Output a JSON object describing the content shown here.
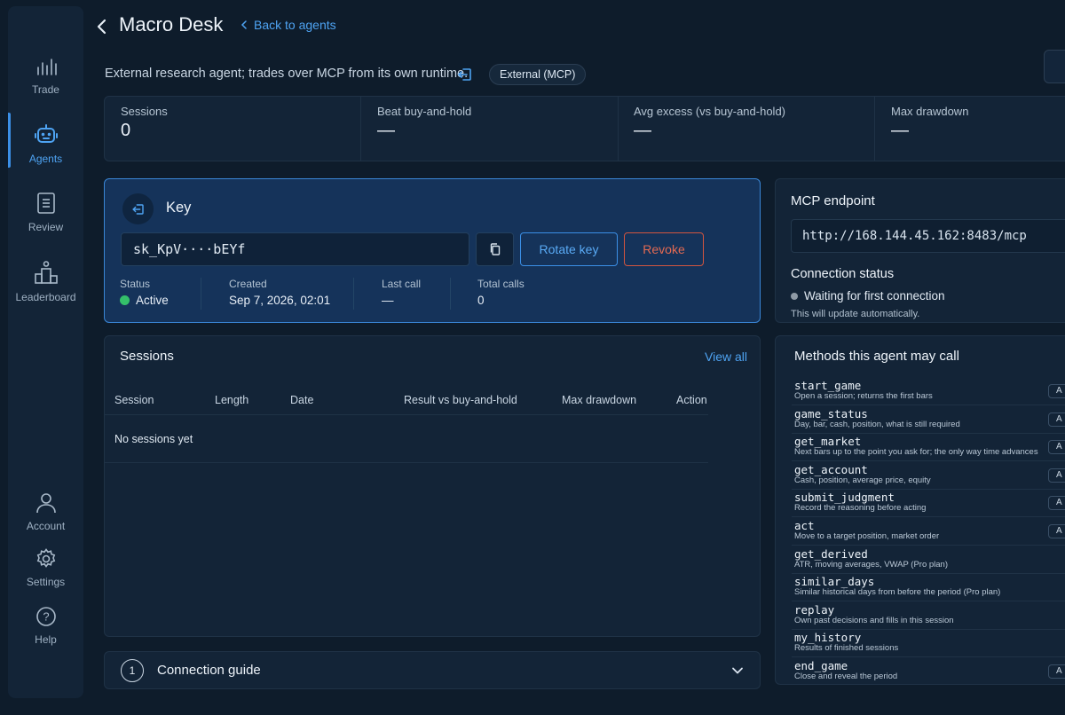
{
  "sidebar": {
    "items": [
      {
        "label": "Trade",
        "icon": "bar-chart-icon"
      },
      {
        "label": "Agents",
        "icon": "robot-icon",
        "active": true
      },
      {
        "label": "Review",
        "icon": "document-icon"
      },
      {
        "label": "Leaderboard",
        "icon": "podium-icon"
      },
      {
        "label": "Account",
        "icon": "user-icon"
      },
      {
        "label": "Settings",
        "icon": "gear-icon"
      },
      {
        "label": "Help",
        "icon": "help-icon"
      }
    ]
  },
  "header": {
    "title": "Macro Desk",
    "back_link": "Back to agents",
    "description": "External research agent; trades over MCP from its own runtime.",
    "badge": "External (MCP)"
  },
  "stats": [
    {
      "label": "Sessions",
      "value": "0"
    },
    {
      "label": "Beat buy-and-hold",
      "value": "—"
    },
    {
      "label": "Avg excess (vs buy-and-hold)",
      "value": "—"
    },
    {
      "label": "Max drawdown",
      "value": "—"
    }
  ],
  "key": {
    "title": "Key",
    "masked_value": "sk_KpV····bEYf",
    "rotate_label": "Rotate key",
    "revoke_label": "Revoke",
    "status_label": "Status",
    "status_value": "Active",
    "created_label": "Created",
    "created_value": "Sep 7, 2026, 02:01",
    "last_call_label": "Last call",
    "last_call_value": "—",
    "total_calls_label": "Total calls",
    "total_calls_value": "0"
  },
  "mcp": {
    "title": "MCP endpoint",
    "url": "http://168.144.45.162:8483/mcp",
    "connection_title": "Connection status",
    "connection_status": "Waiting for first connection",
    "connection_note": "This will update automatically."
  },
  "sessions": {
    "title": "Sessions",
    "view_all": "View all",
    "columns": [
      "Session",
      "Length",
      "Date",
      "Result vs buy-and-hold",
      "Max drawdown",
      "Action"
    ],
    "empty": "No sessions yet"
  },
  "methods": {
    "title": "Methods this agent may call",
    "tag": "A",
    "items": [
      {
        "name": "start_game",
        "desc": "Open a session; returns the first bars",
        "tag": true
      },
      {
        "name": "game_status",
        "desc": "Day, bar, cash, position, what is still required",
        "tag": true
      },
      {
        "name": "get_market",
        "desc": "Next bars up to the point you ask for; the only way time advances",
        "tag": true
      },
      {
        "name": "get_account",
        "desc": "Cash, position, average price, equity",
        "tag": true
      },
      {
        "name": "submit_judgment",
        "desc": "Record the reasoning before acting",
        "tag": true
      },
      {
        "name": "act",
        "desc": "Move to a target position, market order",
        "tag": true
      },
      {
        "name": "get_derived",
        "desc": "ATR, moving averages, VWAP (Pro plan)",
        "tag": false
      },
      {
        "name": "similar_days",
        "desc": "Similar historical days from before the period (Pro plan)",
        "tag": false
      },
      {
        "name": "replay",
        "desc": "Own past decisions and fills in this session",
        "tag": false
      },
      {
        "name": "my_history",
        "desc": "Results of finished sessions",
        "tag": false
      },
      {
        "name": "end_game",
        "desc": "Close and reveal the period",
        "tag": true
      }
    ]
  },
  "guide": {
    "number": "1",
    "title": "Connection guide"
  }
}
